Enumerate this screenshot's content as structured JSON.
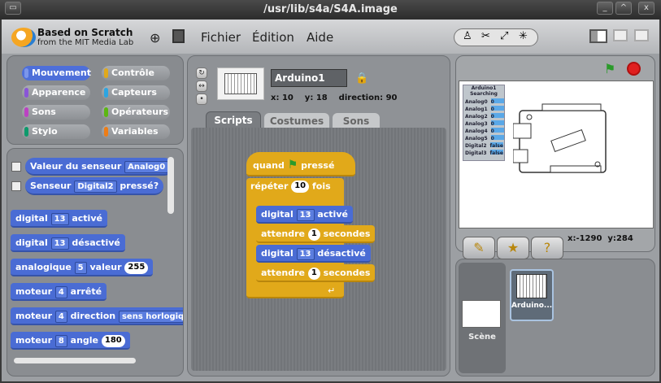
{
  "window": {
    "title": "/usr/lib/s4a/S4A.image",
    "min": "_",
    "max": "^",
    "close": "x"
  },
  "logo": {
    "line1": "Based on Scratch",
    "line2": "from the MIT Media Lab"
  },
  "menu": {
    "file": "Fichier",
    "edit": "Édition",
    "help": "Aide"
  },
  "categories": [
    {
      "label": "Mouvement",
      "color": "#4a6cd4"
    },
    {
      "label": "Contrôle",
      "color": "#e1a91a"
    },
    {
      "label": "Apparence",
      "color": "#8a55d7"
    },
    {
      "label": "Capteurs",
      "color": "#2ca5e2"
    },
    {
      "label": "Sons",
      "color": "#bb42c3"
    },
    {
      "label": "Opérateurs",
      "color": "#5cb712"
    },
    {
      "label": "Stylo",
      "color": "#0e9a6c"
    },
    {
      "label": "Variables",
      "color": "#ee7d16"
    }
  ],
  "palette": {
    "sensor_value": {
      "label": "Valeur du senseur",
      "dd": "Analog0"
    },
    "sensor": {
      "label": "Senseur",
      "dd": "Digital2",
      "suffix": "pressé?"
    },
    "digital_on": {
      "label": "digital",
      "dd": "13",
      "suffix": "activé"
    },
    "digital_off": {
      "label": "digital",
      "dd": "13",
      "suffix": "désactivé"
    },
    "analog": {
      "label": "analogique",
      "dd": "5",
      "mid": "valeur",
      "num": "255"
    },
    "motor_off": {
      "label": "moteur",
      "dd": "4",
      "suffix": "arrêté"
    },
    "motor_dir": {
      "label": "moteur",
      "dd": "4",
      "mid": "direction",
      "dd2": "sens horlogiq"
    },
    "motor_angle": {
      "label": "moteur",
      "dd": "8",
      "mid": "angle",
      "num": "180"
    }
  },
  "sprite": {
    "name": "Arduino1",
    "x_label": "x:",
    "x": "10",
    "y_label": "y:",
    "y": "18",
    "dir_label": "direction:",
    "dir": "90"
  },
  "tabs": {
    "scripts": "Scripts",
    "costumes": "Costumes",
    "sounds": "Sons"
  },
  "script": {
    "hat": {
      "label": "quand",
      "suffix": "pressé"
    },
    "repeat": {
      "label": "répéter",
      "num": "10",
      "suffix": "fois"
    },
    "b1": {
      "label": "digital",
      "dd": "13",
      "suffix": "activé"
    },
    "b2": {
      "label": "attendre",
      "num": "1",
      "suffix": "secondes"
    },
    "b3": {
      "label": "digital",
      "dd": "13",
      "suffix": "désactivé"
    },
    "b4": {
      "label": "attendre",
      "num": "1",
      "suffix": "secondes"
    }
  },
  "board": {
    "title1": "Arduino1",
    "title2": "Searching",
    "pins": [
      {
        "label": "Analog0",
        "val": "0"
      },
      {
        "label": "Analog1",
        "val": "0"
      },
      {
        "label": "Analog2",
        "val": "0"
      },
      {
        "label": "Analog3",
        "val": "0"
      },
      {
        "label": "Analog4",
        "val": "0"
      },
      {
        "label": "Analog5",
        "val": "0"
      },
      {
        "label": "Digital2",
        "val": "false"
      },
      {
        "label": "Digital3",
        "val": "false"
      }
    ]
  },
  "stage_coords": {
    "x_label": "x:",
    "x": "-1290",
    "y_label": "y:",
    "y": "284"
  },
  "sprites_list": {
    "stage": "Scène",
    "sprite": "Arduino..."
  }
}
